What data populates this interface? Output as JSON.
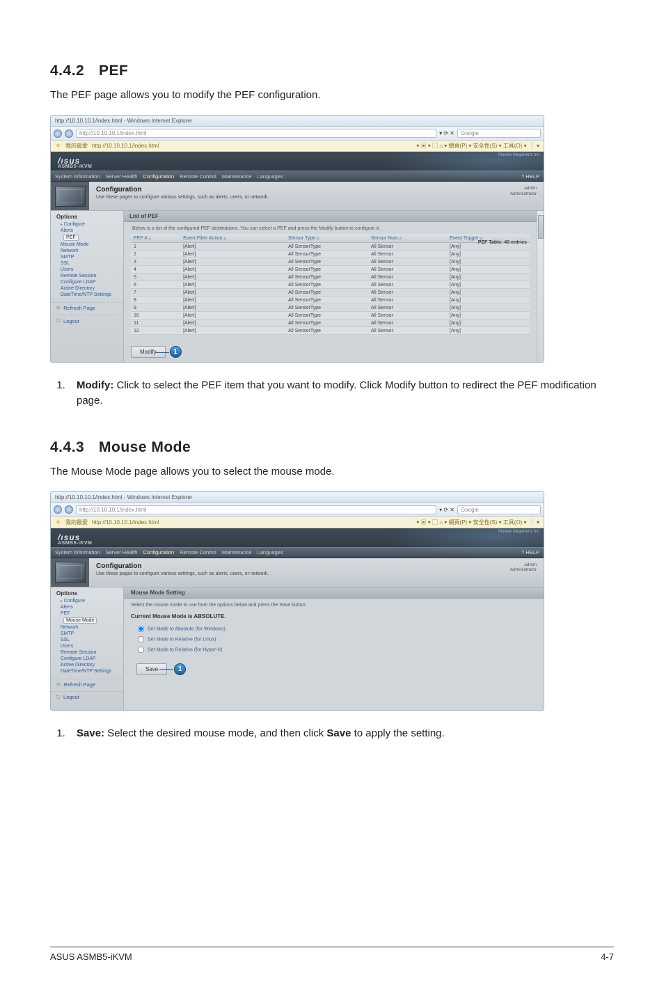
{
  "section1": {
    "number": "4.4.2",
    "title": "PEF",
    "intro": "The PEF page allows you to modify the PEF configuration.",
    "instruction": {
      "label": "Modify:",
      "text": " Click to select the PEF item that you want to modify. Click Modify button to redirect the PEF modification page."
    }
  },
  "section2": {
    "number": "4.4.3",
    "title": "Mouse Mode",
    "intro": "The Mouse Mode page allows you to select the mouse mode.",
    "instruction": {
      "label": "Save:",
      "text": " Select the desired mouse mode, and then click ",
      "bold2": "Save",
      "text2": " to apply the setting."
    }
  },
  "footer": {
    "left": "ASUS ASMB5-iKVM",
    "right": "4-7"
  },
  "browser": {
    "titlebar": "http://10.10.10.1/index.html - Windows Internet Explorer",
    "url": "http://10.10.10.1/index.html",
    "search": "Google",
    "fav_label": "我的最愛",
    "fav_url": "http://10.10.10.1/index.html",
    "toolbar_right": "▾ ▣ ▾ ▢ ⌂ ▾ 網頁(P) ▾ 安全性(S) ▾ 工具(O) ▾ ❔ ▾",
    "brand": "/ısus",
    "brand_sub": "ASMB5-iKVM",
    "corner": "Mustek Megahertz Inc",
    "menu": [
      "System Information",
      "Server Health",
      "Configuration",
      "Remote Control",
      "Maintenance",
      "Languages"
    ],
    "help": "? HELP",
    "conf_title": "Configuration",
    "conf_sub": "Use these pages to configure various settings, such as alerts, users, or network.",
    "conf_user": "admin",
    "conf_role": "Administrator"
  },
  "sidebar": {
    "title": "Options",
    "configure": "Configure",
    "items_pef": [
      "Alerts",
      "PEF",
      "Mouse Mode",
      "Network",
      "SMTP",
      "SSL",
      "Users",
      "Remote Session",
      "Configure LDAP",
      "Active Directory",
      "DateTime/NTP Settings"
    ],
    "refresh": "Refresh Page",
    "logout": "Logout"
  },
  "pef_panel": {
    "header": "List of PEF",
    "sub": "Below is a list of the configured PEF destinations. You can select a PEF and press the Modify button to configure it.",
    "count": "PEF Table: 40 entries",
    "columns": [
      "PEF # ▵",
      "Event Filter Action ▵",
      "Sensor Type ▵",
      "Sensor Num ▵",
      "Event Trigger ▵"
    ],
    "rows": [
      {
        "n": "1",
        "a": "[Alert]",
        "s": "All SensorType",
        "sn": "All Sensor",
        "e": "[Any]"
      },
      {
        "n": "2",
        "a": "[Alert]",
        "s": "All SensorType",
        "sn": "All Sensor",
        "e": "[Any]"
      },
      {
        "n": "3",
        "a": "[Alert]",
        "s": "All SensorType",
        "sn": "All Sensor",
        "e": "[Any]"
      },
      {
        "n": "4",
        "a": "[Alert]",
        "s": "All SensorType",
        "sn": "All Sensor",
        "e": "[Any]"
      },
      {
        "n": "5",
        "a": "[Alert]",
        "s": "All SensorType",
        "sn": "All Sensor",
        "e": "[Any]"
      },
      {
        "n": "6",
        "a": "[Alert]",
        "s": "All SensorType",
        "sn": "All Sensor",
        "e": "[Any]"
      },
      {
        "n": "7",
        "a": "[Alert]",
        "s": "All SensorType",
        "sn": "All Sensor",
        "e": "[Any]"
      },
      {
        "n": "8",
        "a": "[Alert]",
        "s": "All SensorType",
        "sn": "All Sensor",
        "e": "[Any]"
      },
      {
        "n": "9",
        "a": "[Alert]",
        "s": "All SensorType",
        "sn": "All Sensor",
        "e": "[Any]"
      },
      {
        "n": "10",
        "a": "[Alert]",
        "s": "All SensorType",
        "sn": "All Sensor",
        "e": "[Any]"
      },
      {
        "n": "11",
        "a": "[Alert]",
        "s": "All SensorType",
        "sn": "All Sensor",
        "e": "[Any]"
      },
      {
        "n": "12",
        "a": "[Alert]",
        "s": "All SensorType",
        "sn": "All Sensor",
        "e": "[Any]"
      }
    ],
    "button": "Modify",
    "marker": "1"
  },
  "mm_panel": {
    "header": "Mouse Mode Setting",
    "sub": "Select the mouse mode to use from the options below and press the Save button.",
    "current": "Current Mouse Mode is ABSOLUTE.",
    "opt1": "Set Mode to Absolute (for Windows)",
    "opt2": "Set Mode to Relative (for Linux)",
    "opt3": "Set Mode to Relative (for Hyper-V)",
    "button": "Save",
    "marker": "1",
    "sidebar_sel": "Mouse Mode"
  }
}
